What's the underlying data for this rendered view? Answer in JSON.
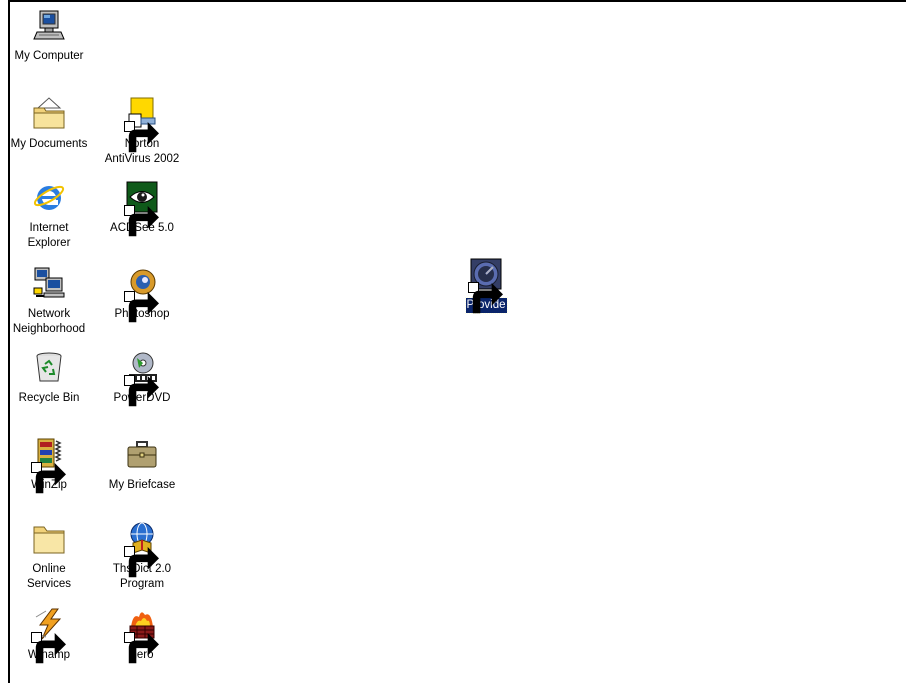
{
  "desktop": {
    "icons": [
      {
        "id": "my-computer",
        "label": "My Computer"
      },
      {
        "id": "my-documents",
        "label": "My Documents"
      },
      {
        "id": "norton",
        "label": "Norton\nAntiVirus 2002"
      },
      {
        "id": "ie",
        "label": "Internet\nExplorer"
      },
      {
        "id": "acdsee",
        "label": "ACDSee 5.0"
      },
      {
        "id": "network",
        "label": "Network\nNeighborhood"
      },
      {
        "id": "photoshop",
        "label": "Photoshop"
      },
      {
        "id": "recycle",
        "label": "Recycle Bin"
      },
      {
        "id": "powerdvd",
        "label": "PowerDVD"
      },
      {
        "id": "winzip",
        "label": "WinZip"
      },
      {
        "id": "briefcase",
        "label": "My Briefcase"
      },
      {
        "id": "online",
        "label": "Online\nServices"
      },
      {
        "id": "thsdict",
        "label": "ThsDict 2.0\nProgram"
      },
      {
        "id": "winamp",
        "label": "Winamp"
      },
      {
        "id": "nero",
        "label": "nero"
      },
      {
        "id": "provide",
        "label": "Provide"
      }
    ]
  }
}
